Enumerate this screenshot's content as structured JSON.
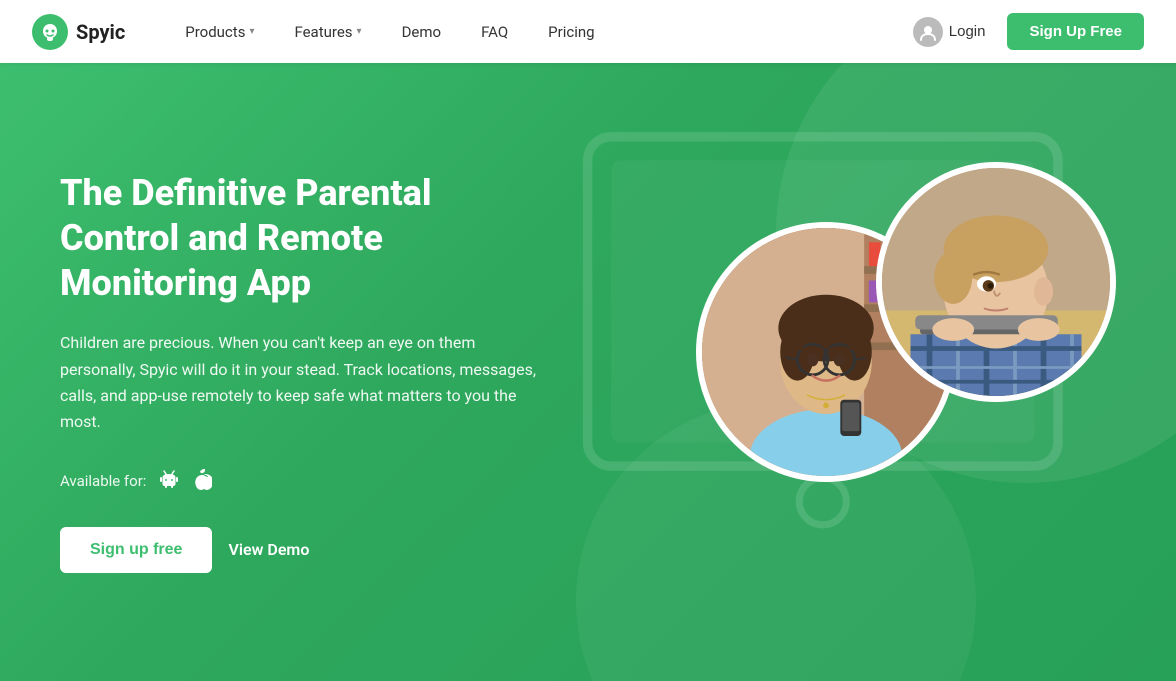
{
  "brand": {
    "name": "Spyic"
  },
  "navbar": {
    "products_label": "Products",
    "features_label": "Features",
    "demo_label": "Demo",
    "faq_label": "FAQ",
    "pricing_label": "Pricing",
    "login_label": "Login",
    "signup_label": "Sign Up Free"
  },
  "hero": {
    "title": "The Definitive Parental Control and Remote Monitoring App",
    "description": "Children are precious. When you can't keep an eye on them personally, Spyic will do it in your stead. Track locations, messages, calls, and app-use remotely to keep safe what matters to you the most.",
    "available_label": "Available for:",
    "btn_signup": "Sign up free",
    "btn_demo": "View Demo"
  },
  "colors": {
    "green": "#3dbe6e",
    "white": "#ffffff"
  }
}
